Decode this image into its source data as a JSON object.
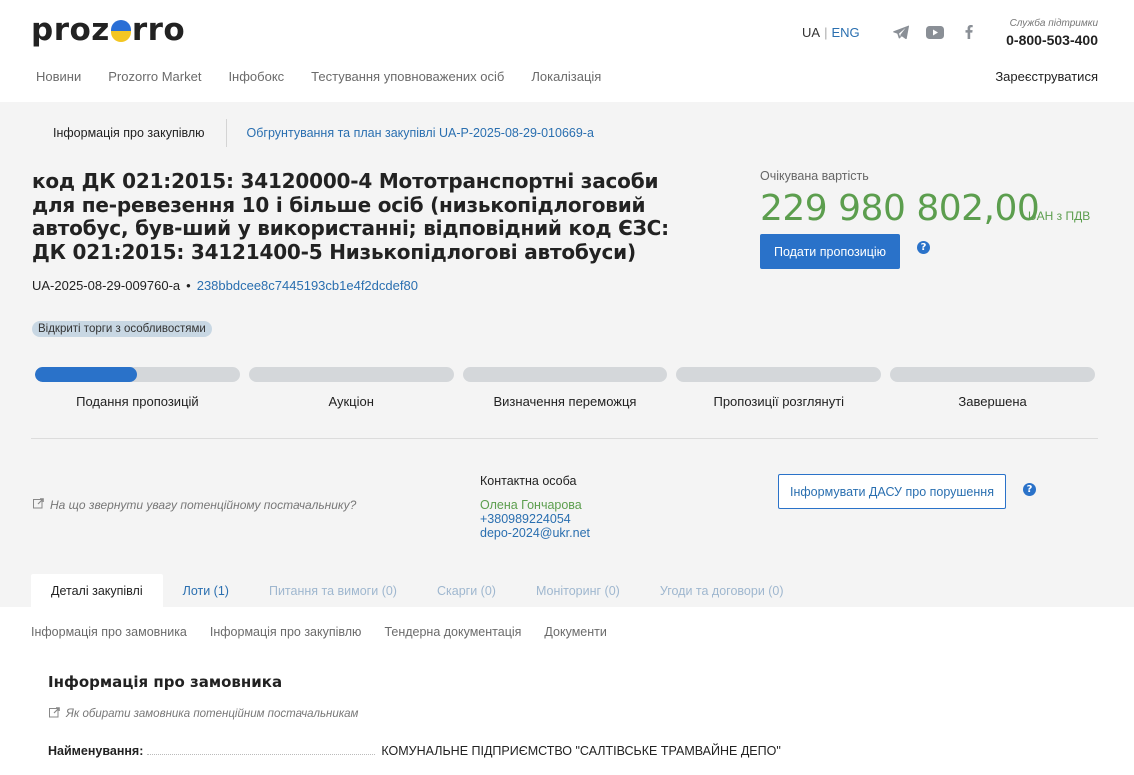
{
  "header": {
    "logo": {
      "left": "proz",
      "right": "rro"
    },
    "lang": {
      "ua": "UA",
      "eng": "ENG"
    },
    "support": {
      "label": "Служба підтримки",
      "phone": "0-800-503-400"
    },
    "nav": [
      "Новини",
      "Prozorro Market",
      "Інфобокс",
      "Тестування уповноважених осіб",
      "Локалізація"
    ],
    "register": "Зареєструватися",
    "colors": {
      "flag_blue": "#2a6fd6",
      "flag_yellow": "#f3c623"
    }
  },
  "subtabs": {
    "info": "Інформація про закупівлю",
    "plan": "Обгрунтування та план закупівлі UA-P-2025-08-29-010669-a"
  },
  "tender": {
    "title": "код ДК 021:2015: 34120000-4 Мототранспортні засоби для пе-ревезення 10 і більше осіб (низькопідлоговий автобус, був-ший у використанні; відповідний код ЄЗС: ДК 021:2015: 34121400-5 Низькопідлогові автобуси)",
    "id": "UA-2025-08-29-009760-a",
    "separator": "•",
    "hash": "238bbdcee8c7445193cb1e4f2dcdef80",
    "badge": "Відкриті торги з особливостями",
    "expected_label": "Очікувана вартість",
    "amount": "229 980 802,00",
    "amount_unit": "UAH з ПДВ",
    "submit": "Подати пропозицію",
    "help": "?"
  },
  "stepper": {
    "steps": [
      {
        "label": "Подання пропозицій",
        "progress": 0.5
      },
      {
        "label": "Аукціон",
        "progress": 0
      },
      {
        "label": "Визначення переможця",
        "progress": 0
      },
      {
        "label": "Пропозиції розглянуті",
        "progress": 0
      },
      {
        "label": "Завершена",
        "progress": 0
      }
    ]
  },
  "contact": {
    "attention": "На що звернути увагу потенційному постачальнику?",
    "label": "Контактна особа",
    "name": "Олена Гончарова",
    "phone": "+380989224054",
    "email": "depo-2024@ukr.net",
    "dasu": "Інформувати ДАСУ про порушення"
  },
  "tabs": [
    "Деталі закупівлі",
    "Лоти (1)",
    "Питання та вимоги (0)",
    "Скарги (0)",
    "Моніторинг (0)",
    "Угоди та договори (0)"
  ],
  "secnav": [
    "Інформація про замовника",
    "Інформація про закупівлю",
    "Тендерна документація",
    "Документи"
  ],
  "customer": {
    "title": "Інформація про замовника",
    "howto": "Як обирати замовника потенційним постачальникам",
    "name_label": "Найменування:",
    "name_value": "КОМУНАЛЬНЕ ПІДПРИЄМСТВО \"САЛТІВСЬКЕ ТРАМВАЙНЕ ДЕПО\""
  },
  "colors": {
    "primary": "#2a72c9",
    "link": "#2a6fb0",
    "green": "#5c9e4e",
    "badge_bg": "#c8d7e3",
    "grey_bg": "#f4f4f4"
  },
  "icons": {
    "telegram": "telegram-icon",
    "youtube": "youtube-icon",
    "facebook": "facebook-icon",
    "external": "external-link-icon"
  }
}
